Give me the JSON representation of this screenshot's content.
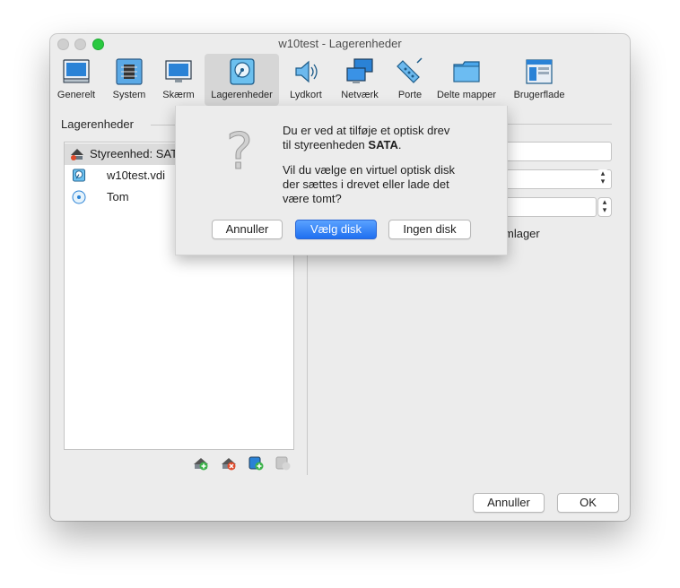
{
  "window": {
    "title": "w10test - Lagerenheder"
  },
  "toolbar": {
    "items": [
      {
        "label": "Generelt",
        "icon": "general-screen-icon"
      },
      {
        "label": "System",
        "icon": "chip-icon"
      },
      {
        "label": "Skærm",
        "icon": "display-icon"
      },
      {
        "label": "Lagerenheder",
        "icon": "storage-disk-icon",
        "active": true
      },
      {
        "label": "Lydkort",
        "icon": "speaker-icon"
      },
      {
        "label": "Netværk",
        "icon": "network-icon"
      },
      {
        "label": "Porte",
        "icon": "port-icon"
      },
      {
        "label": "Delte mapper",
        "icon": "folder-icon"
      },
      {
        "label": "Brugerflade",
        "icon": "ui-window-icon"
      }
    ]
  },
  "storage": {
    "section_label": "Lagerenheder",
    "tree": {
      "controller_label": "Styreenhed: SATA",
      "controller_visible": "Styreenhed: SAT",
      "disk_label": "w10test.vdi",
      "optical_label": "Tom"
    },
    "actions": [
      "add-controller-icon",
      "remove-controller-icon",
      "add-attachment-icon",
      "remove-attachment-icon"
    ]
  },
  "details": {
    "partial_text": "mlager"
  },
  "footer": {
    "cancel_label": "Annuller",
    "ok_label": "OK"
  },
  "dialog": {
    "line1": "Du er ved at tilføje et optisk drev",
    "line2_prefix": "til styreenheden ",
    "line2_bold": "SATA",
    "line2_suffix": ".",
    "question1": "Vil du vælge en virtuel optisk disk",
    "question2": "der sættes i drevet eller lade det",
    "question3": "være tomt?",
    "cancel_label": "Annuller",
    "choose_label": "Vælg disk",
    "none_label": "Ingen disk"
  },
  "colors": {
    "accent": "#1f6ff0",
    "zoom_button": "#2ac940"
  }
}
